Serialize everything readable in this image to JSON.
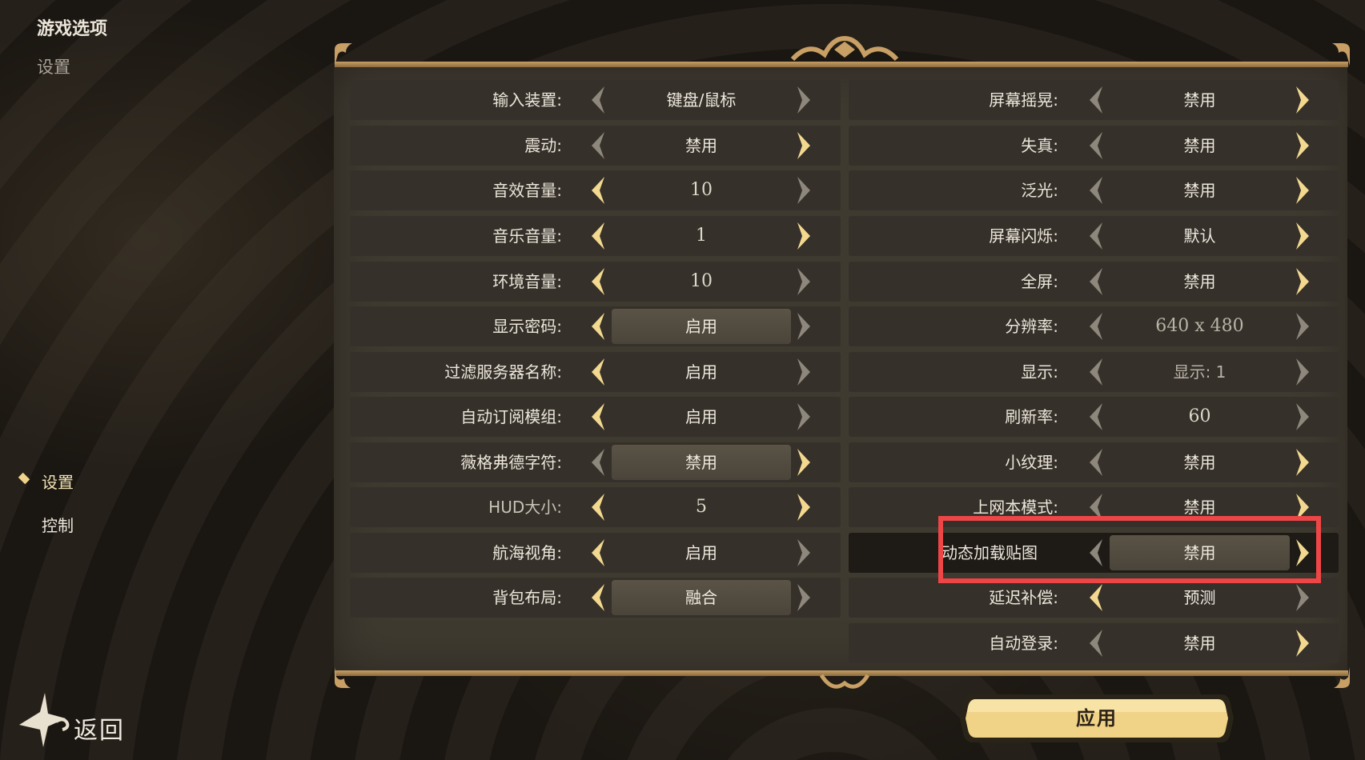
{
  "header": {
    "title": "游戏选项",
    "subtitle": "设置"
  },
  "nav": {
    "items": [
      {
        "label": "设置",
        "active": true
      },
      {
        "label": "控制",
        "active": false
      }
    ]
  },
  "back": {
    "label": "返回",
    "icon": "back-arrow-icon"
  },
  "settings_left": [
    {
      "label": "输入装置:",
      "value": "键盘/鼠标"
    },
    {
      "label": "震动:",
      "value": "禁用"
    },
    {
      "label": "音效音量:",
      "value": "10"
    },
    {
      "label": "音乐音量:",
      "value": "1"
    },
    {
      "label": "环境音量:",
      "value": "10"
    },
    {
      "label": "显示密码:",
      "value": "启用"
    },
    {
      "label": "过滤服务器名称:",
      "value": "启用"
    },
    {
      "label": "自动订阅模组:",
      "value": "启用"
    },
    {
      "label": "薇格弗德字符:",
      "value": "禁用"
    },
    {
      "label": "HUD大小:",
      "value": "5"
    },
    {
      "label": "航海视角:",
      "value": "启用"
    },
    {
      "label": "背包布局:",
      "value": "融合"
    }
  ],
  "settings_right": [
    {
      "label": "屏幕摇晃:",
      "value": "禁用"
    },
    {
      "label": "失真:",
      "value": "禁用"
    },
    {
      "label": "泛光:",
      "value": "禁用"
    },
    {
      "label": "屏幕闪烁:",
      "value": "默认"
    },
    {
      "label": "全屏:",
      "value": "禁用"
    },
    {
      "label": "分辨率:",
      "value": "640 x 480"
    },
    {
      "label": "显示:",
      "value": "显示: 1"
    },
    {
      "label": "刷新率:",
      "value": "60"
    },
    {
      "label": "小纹理:",
      "value": "禁用"
    },
    {
      "label": "上网本模式:",
      "value": "禁用"
    },
    {
      "label": "动态加载贴图",
      "value": "禁用"
    },
    {
      "label": "延迟补偿:",
      "value": "预测"
    },
    {
      "label": "自动登录:",
      "value": "禁用"
    }
  ],
  "apply": {
    "label": "应用"
  },
  "colors": {
    "arrow_active": "#f3d98f",
    "arrow_inactive": "#8d877c",
    "highlight_box": "#ee4646",
    "frame_gold": "#c89f64",
    "apply_gold": "#f0d387"
  },
  "icons": {
    "prev": "chevron-left-icon",
    "next": "chevron-right-icon"
  }
}
